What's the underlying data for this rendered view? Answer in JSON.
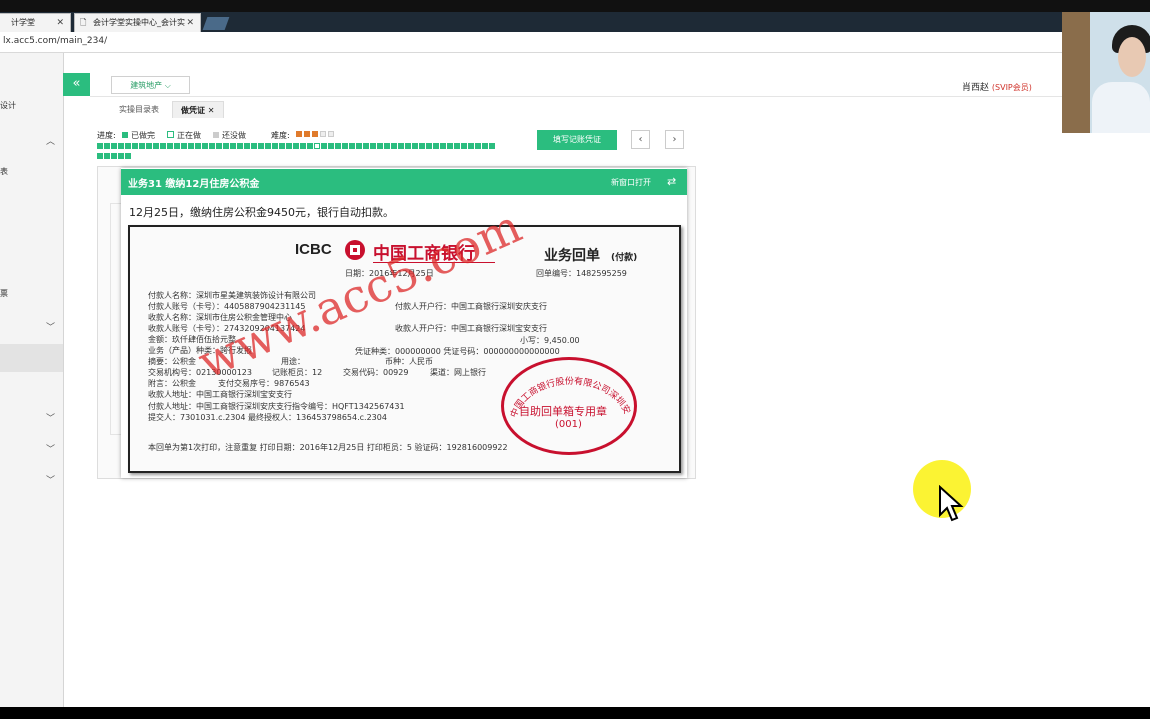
{
  "browser": {
    "tabs": [
      {
        "label": "计学堂"
      },
      {
        "label": "会计学堂实操中心_会计实"
      }
    ],
    "url": "lx.acc5.com/main_234/"
  },
  "sidebar": {
    "labels": [
      "设计",
      "表",
      "票"
    ],
    "chevrons": [
      "chevron-up-icon",
      "chevron-down-icon",
      "chevron-down-icon",
      "chevron-down-icon",
      "chevron-down-icon"
    ]
  },
  "header": {
    "collapse_icon": "«",
    "dept_select": "建筑地产",
    "user_name": "肖西赵",
    "user_level": "(SVIP会员)"
  },
  "page_tabs": [
    {
      "label": "实操目录表"
    },
    {
      "label": "做凭证"
    }
  ],
  "progress": {
    "label": "进度:",
    "legend": [
      {
        "label": "已做完",
        "color": "#2bbd7f"
      },
      {
        "label": "正在做",
        "color": "#ffffff"
      },
      {
        "label": "还没做",
        "color": "#cccccc"
      }
    ],
    "difficulty_label": "难度:",
    "difficulty_value": 3,
    "difficulty_max": 5,
    "total_items": 62,
    "current_item": 32
  },
  "actions": {
    "fill_voucher": "填写记账凭证",
    "prev": "‹",
    "next": "›"
  },
  "dialog": {
    "title": "业务31 缴纳12月住房公积金",
    "new_window": "新窗口打开",
    "description": "12月25日，缴纳住房公积金9450元，银行自动扣款。"
  },
  "receipt": {
    "icbc": "ICBC",
    "bank_name": "中国工商银行",
    "title": "业务回单",
    "type": "(付款)",
    "date": "日期：2016年12月25日",
    "receipt_no": "回单编号：1482595259",
    "lines_left": [
      "付款人名称：深圳市星美建筑装饰设计有限公司",
      "付款人账号（卡号）：4405887904231145",
      "收款人名称：深圳市住房公积金管理中心",
      "收款人账号（卡号）：2743209204137424",
      "金额：玖仟肆佰伍拾元整",
      "业务（产品）种类：跨行发报",
      "摘要：公积金",
      "交易机构号：02130000123",
      "附言：公积金",
      "收款人地址：中国工商银行深圳宝安支行",
      "付款人地址：中国工商银行深圳安庆支行指令编号：HQFT1342567431",
      "提交人：7301031.c.2304 最终授权人：136453798654.c.2304"
    ],
    "payer_bank": "付款人开户行：中国工商银行深圳安庆支行",
    "payee_bank": "收款人开户行：中国工商银行深圳宝安支行",
    "amount_small": "小写：9,450.00",
    "voucher_type": "凭证种类：000000000 凭证号码：000000000000000",
    "purpose": "用途：",
    "currency": "币种：人民币",
    "teller": "记账柜员：12",
    "trade_code": "交易代码：00929",
    "channel": "渠道：网上银行",
    "serial": "支付交易序号：9876543",
    "footer": "本回单为第1次打印，注意重复   打印日期：2016年12月25日   打印柜员：5   验证码：192816009922",
    "watermark": "www.acc5.com",
    "stamp_arc": "中国工商银行股份有限公司深圳安庆支行",
    "stamp_title": "自助回单箱专用章",
    "stamp_code": "(001)"
  }
}
